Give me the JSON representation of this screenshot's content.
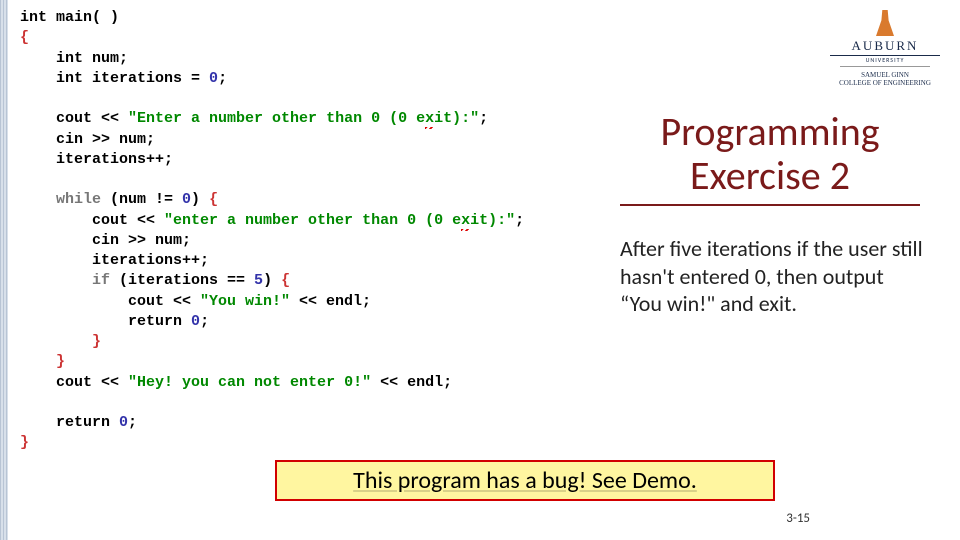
{
  "logo": {
    "name": "AUBURN",
    "sub1": "UNIVERSITY",
    "sub2": "SAMUEL GINN",
    "sub3": "COLLEGE OF ENGINEERING"
  },
  "title": "Programming Exercise 2",
  "desc": "After five iterations if the user still hasn't entered 0, then output “You win!\" and exit.",
  "bug": "This program has a bug! See Demo.",
  "page": "3-15",
  "code": {
    "l1a": "int",
    "l1b": " main( )",
    "l2": "{",
    "l3a": "    int",
    "l3b": " num;",
    "l4a": "    int",
    "l4b": " iterations = ",
    "l4c": "0",
    "l4d": ";",
    "l6a": "    cout << ",
    "l6b": "\"Enter a number other than 0 (0 e",
    "l6bx": "x",
    "l6c": "it):\"",
    "l6d": ";",
    "l7": "    cin >> num;",
    "l8": "    iterations++;",
    "l10a": "    while",
    "l10b": " (num != ",
    "l10c": "0",
    "l10d": ") ",
    "l10e": "{",
    "l11a": "        cout << ",
    "l11b": "\"enter a number other than 0 (0 e",
    "l11bx": "x",
    "l11c": "it):\"",
    "l11d": ";",
    "l12": "        cin >> num;",
    "l13": "        iterations++;",
    "l14a": "        if",
    "l14b": " (iterations == ",
    "l14c": "5",
    "l14d": ") ",
    "l14e": "{",
    "l15a": "            cout << ",
    "l15b": "\"You win!\"",
    "l15c": " << endl;",
    "l16a": "            return",
    "l16b": " ",
    "l16c": "0",
    "l16d": ";",
    "l17": "        }",
    "l18": "    }",
    "l19a": "    cout << ",
    "l19b": "\"Hey! you can not enter 0!\"",
    "l19c": " << endl;",
    "l21a": "    return",
    "l21b": " ",
    "l21c": "0",
    "l21d": ";",
    "l22": "}"
  }
}
